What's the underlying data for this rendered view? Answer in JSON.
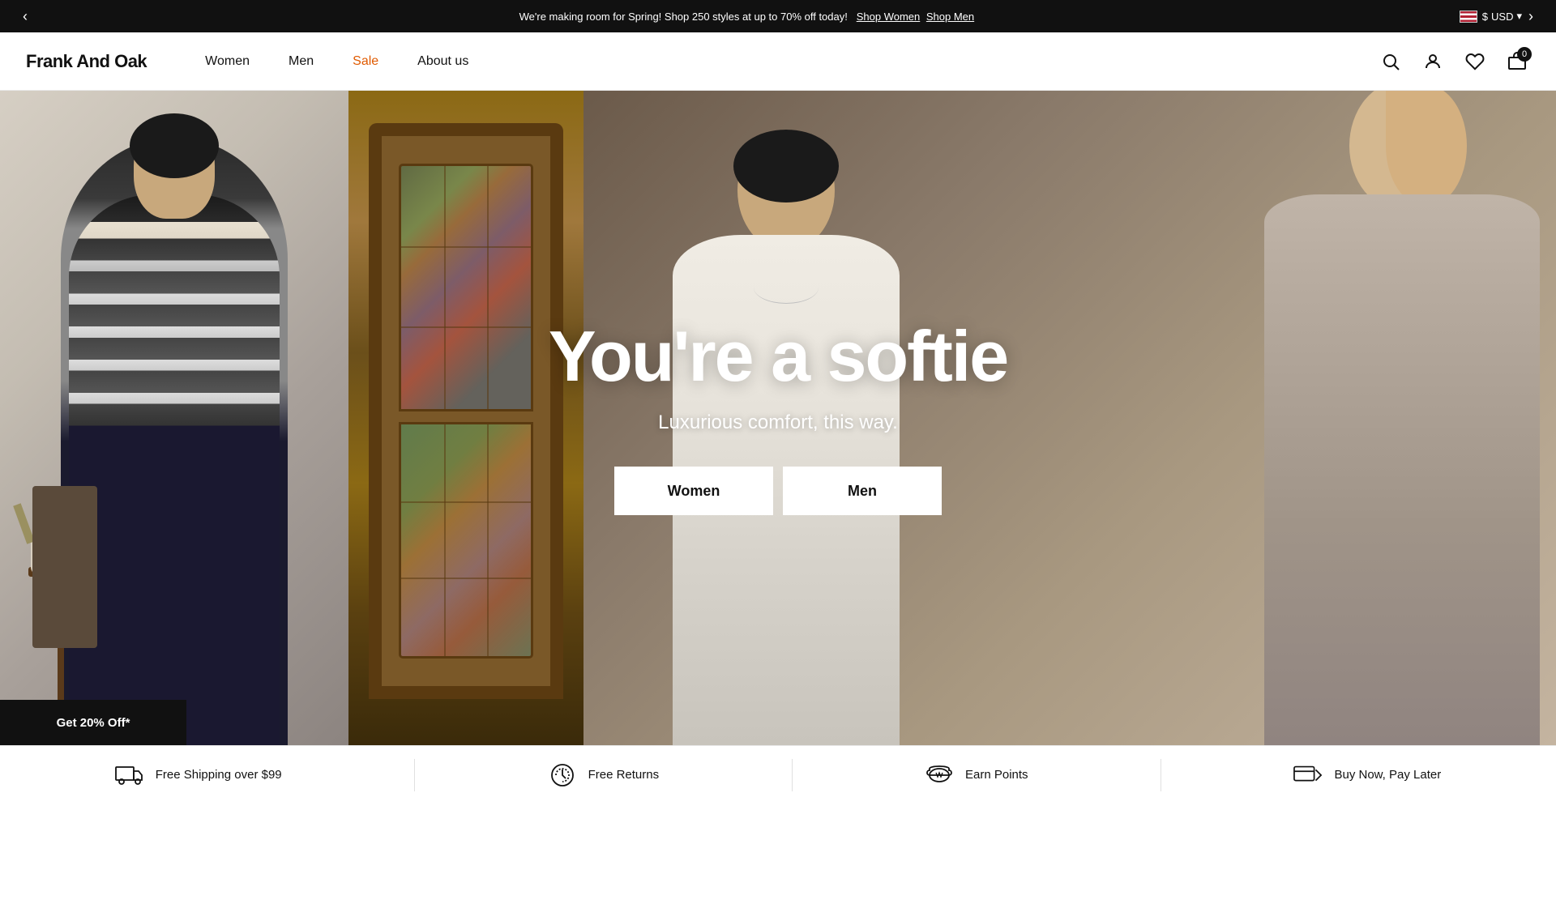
{
  "announcement": {
    "text": "We're making room for Spring! Shop 250 styles at up to 70% off today!",
    "shop_women_label": "Shop Women",
    "shop_men_label": "Shop Men",
    "currency_symbol": "$",
    "currency_code": "USD"
  },
  "nav": {
    "logo": "Frank And Oak",
    "links": [
      {
        "label": "Women",
        "id": "women",
        "is_sale": false
      },
      {
        "label": "Men",
        "id": "men",
        "is_sale": false
      },
      {
        "label": "Sale",
        "id": "sale",
        "is_sale": true
      },
      {
        "label": "About us",
        "id": "about",
        "is_sale": false
      }
    ],
    "cart_count": "0"
  },
  "hero": {
    "title": "You're a softie",
    "subtitle": "Luxurious comfort, this way.",
    "women_btn": "Women",
    "men_btn": "Men",
    "discount_label": "Get 20% Off*"
  },
  "benefits": [
    {
      "id": "shipping",
      "icon": "truck-icon",
      "label": "Free Shipping over $99"
    },
    {
      "id": "returns",
      "icon": "return-icon",
      "label": "Free Returns"
    },
    {
      "id": "points",
      "icon": "points-icon",
      "label": "Earn Points"
    },
    {
      "id": "buynow",
      "icon": "pay-icon",
      "label": "Buy Now, Pay Later"
    }
  ]
}
